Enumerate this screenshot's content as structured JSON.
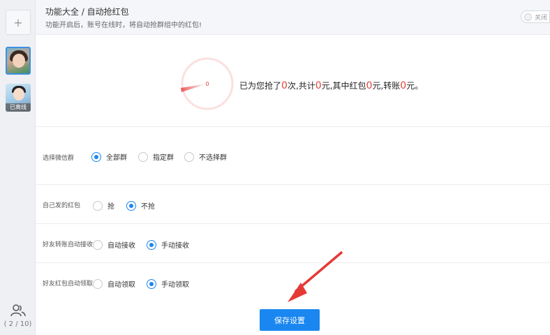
{
  "sidebar": {
    "add_label": "+",
    "accounts": [
      {
        "status": "",
        "selected": true
      },
      {
        "status": "已离线",
        "selected": false
      }
    ],
    "users_icon": "users-icon",
    "page_count": "( 2 / 10)"
  },
  "header": {
    "breadcrumb": "功能大全 / 自动抢红包",
    "subtitle": "功能开启后，账号在线时，将自动抢群组中的红包!",
    "toggle_label": "关闭"
  },
  "stats": {
    "gauge_value": "0",
    "prefix": "已为您抢了",
    "times": "0",
    "times_unit": "次,共计",
    "total": "0",
    "total_unit": "元,其中红包",
    "hongbao": "0",
    "hongbao_unit": "元,转账",
    "transfer": "0",
    "transfer_unit": "元。"
  },
  "form": {
    "group_select": {
      "label": "选择微信群",
      "options": [
        "全部群",
        "指定群",
        "不选择群"
      ],
      "selected": 0
    },
    "own_packets": {
      "label": "自己发的红包",
      "options": [
        "抢",
        "不抢"
      ],
      "selected": 1
    },
    "friend_transfer": {
      "label": "好友转账自动接收",
      "options": [
        "自动接收",
        "手动接收"
      ],
      "selected": 1
    },
    "friend_packet": {
      "label": "好友红包自动领取",
      "options": [
        "自动领取",
        "手动领取"
      ],
      "selected": 1
    }
  },
  "save_label": "保存设置",
  "colors": {
    "accent": "#1a87f0",
    "amount": "#e2453c",
    "annotation": "#e53935"
  }
}
